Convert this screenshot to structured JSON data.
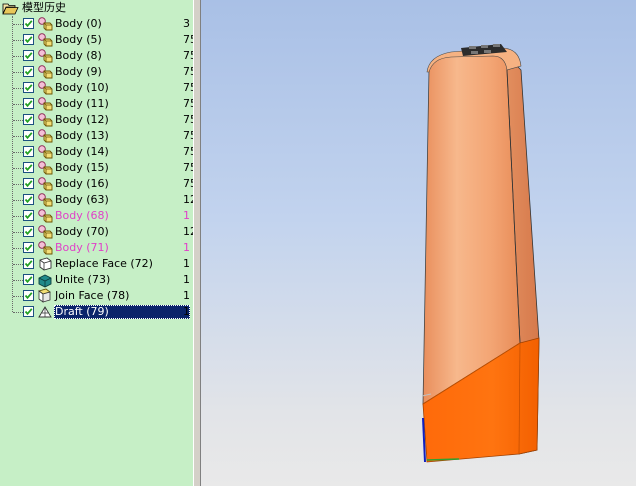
{
  "tree": {
    "root_label": "模型历史",
    "items": [
      {
        "label": "Body (0)",
        "value": "3",
        "icon": "body-icon",
        "style": "normal"
      },
      {
        "label": "Body (5)",
        "value": "75",
        "icon": "body-icon",
        "style": "normal"
      },
      {
        "label": "Body (8)",
        "value": "75",
        "icon": "body-icon",
        "style": "normal"
      },
      {
        "label": "Body (9)",
        "value": "75",
        "icon": "body-icon",
        "style": "normal"
      },
      {
        "label": "Body (10)",
        "value": "75",
        "icon": "body-icon",
        "style": "normal"
      },
      {
        "label": "Body (11)",
        "value": "75",
        "icon": "body-icon",
        "style": "normal"
      },
      {
        "label": "Body (12)",
        "value": "75",
        "icon": "body-icon",
        "style": "normal"
      },
      {
        "label": "Body (13)",
        "value": "75",
        "icon": "body-icon",
        "style": "normal"
      },
      {
        "label": "Body (14)",
        "value": "75",
        "icon": "body-icon",
        "style": "normal"
      },
      {
        "label": "Body (15)",
        "value": "75",
        "icon": "body-icon",
        "style": "normal"
      },
      {
        "label": "Body (16)",
        "value": "75",
        "icon": "body-icon",
        "style": "normal"
      },
      {
        "label": "Body (63)",
        "value": "12",
        "icon": "body-icon",
        "style": "normal"
      },
      {
        "label": "Body (68)",
        "value": "1",
        "icon": "body-icon",
        "style": "pink"
      },
      {
        "label": "Body (70)",
        "value": "12",
        "icon": "body-icon",
        "style": "normal"
      },
      {
        "label": "Body (71)",
        "value": "1",
        "icon": "body-icon",
        "style": "pink"
      },
      {
        "label": "Replace Face (72)",
        "value": "1",
        "icon": "replace-face-icon",
        "style": "normal"
      },
      {
        "label": "Unite (73)",
        "value": "1",
        "icon": "unite-icon",
        "style": "normal"
      },
      {
        "label": "Join Face (78)",
        "value": "1",
        "icon": "join-face-icon",
        "style": "normal"
      },
      {
        "label": "Draft (79)",
        "value": "1",
        "icon": "draft-icon",
        "style": "selected"
      }
    ]
  },
  "colors": {
    "panel_bg": "#c6efc6",
    "selection": "#0a246a",
    "pink_text": "#e040c8",
    "model_peach": "#f0a070",
    "model_orange": "#ff6600"
  }
}
